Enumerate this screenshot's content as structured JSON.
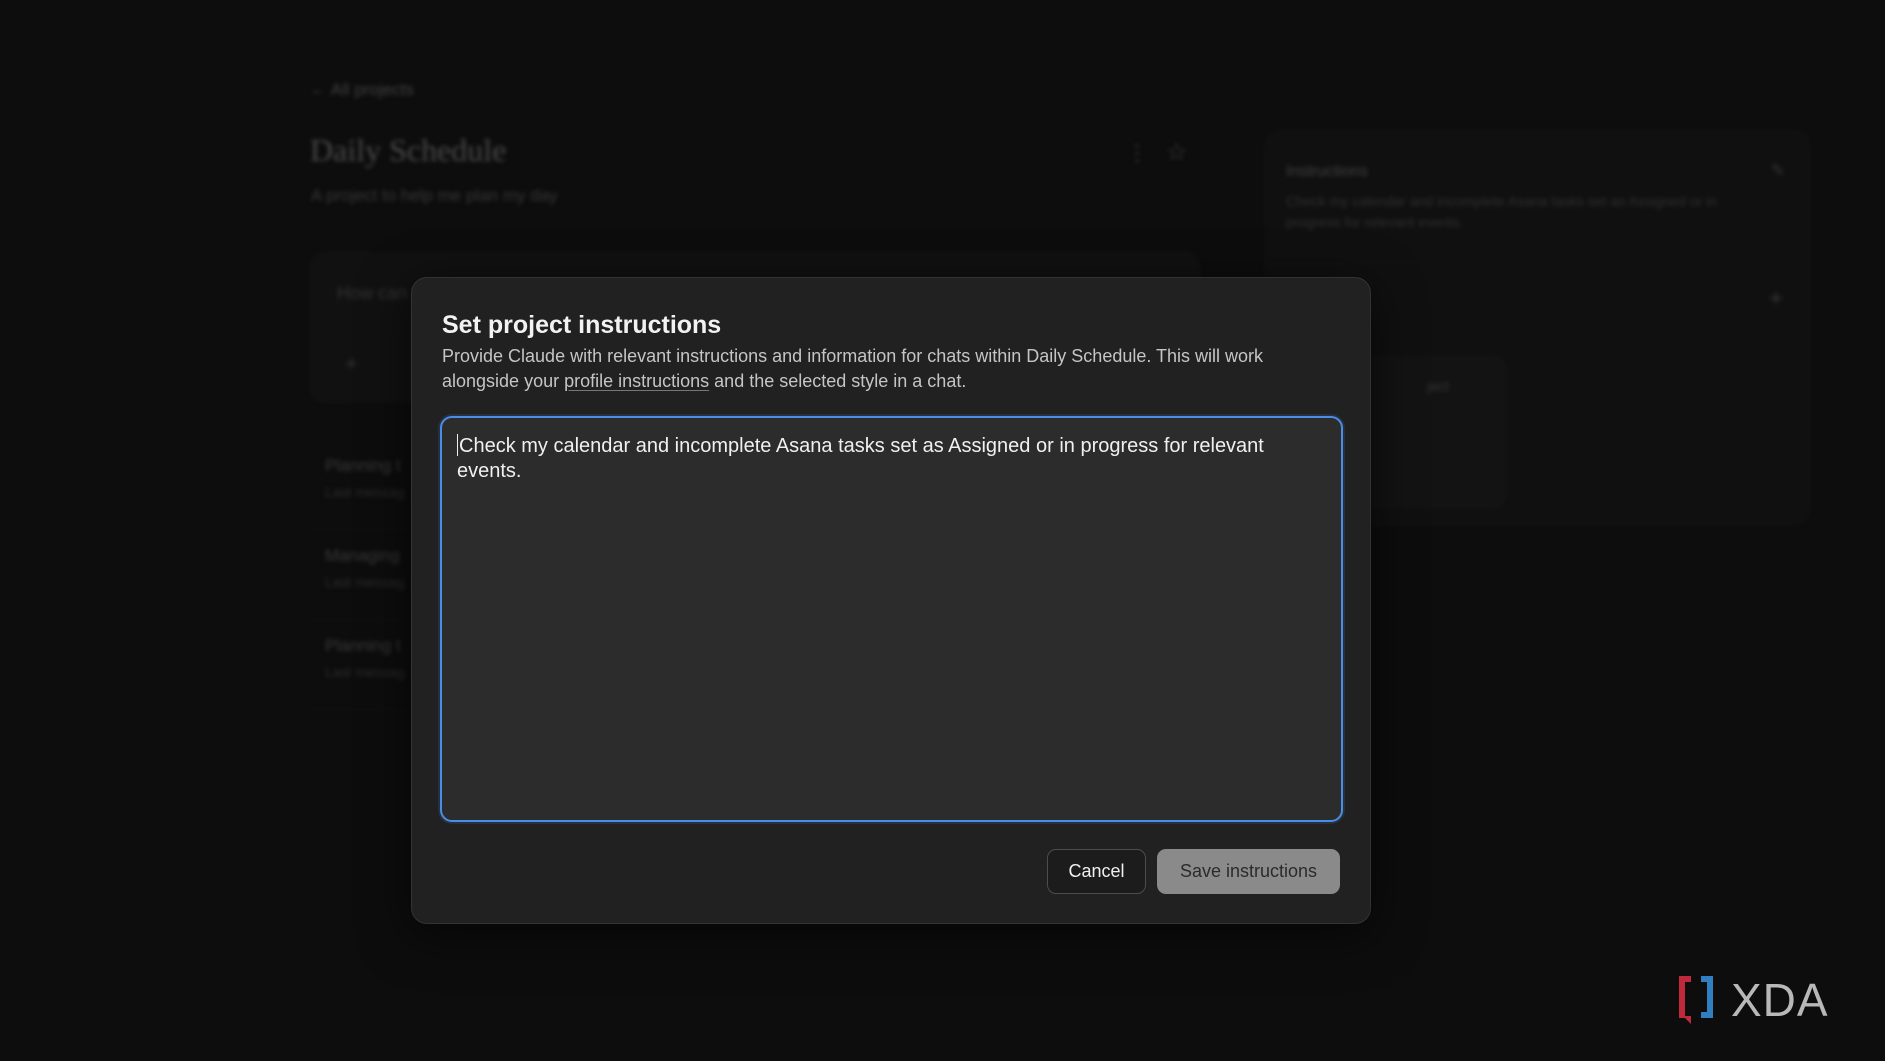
{
  "background": {
    "back_link": "← All projects",
    "project_title": "Daily Schedule",
    "project_subtitle": "A project to help me plan my day",
    "chat_placeholder": "How can",
    "conversations": [
      {
        "title": "Planning t",
        "sub": "Last messag"
      },
      {
        "title": "Managing",
        "sub": "Last messag"
      },
      {
        "title": "Planning t",
        "sub": "Last messag"
      }
    ],
    "side_panel": {
      "instructions_title": "Instructions",
      "instructions_body": "Check my calendar and incomplete Asana tasks set as Assigned or in progress for relevant events.",
      "file_label": "ject"
    }
  },
  "modal": {
    "title": "Set project instructions",
    "desc_before": "Provide Claude with relevant instructions and information for chats within Daily Schedule. This will work alongside your ",
    "desc_link": "profile instructions",
    "desc_after": " and the selected style in a chat.",
    "textarea_value": "Check my calendar and incomplete Asana tasks set as Assigned or in progress for relevant events.",
    "cancel_label": "Cancel",
    "save_label": "Save instructions"
  },
  "watermark": {
    "text": "XDA",
    "colors": {
      "left_bracket": "#c0283c",
      "right_bracket": "#2f7fc1"
    }
  }
}
